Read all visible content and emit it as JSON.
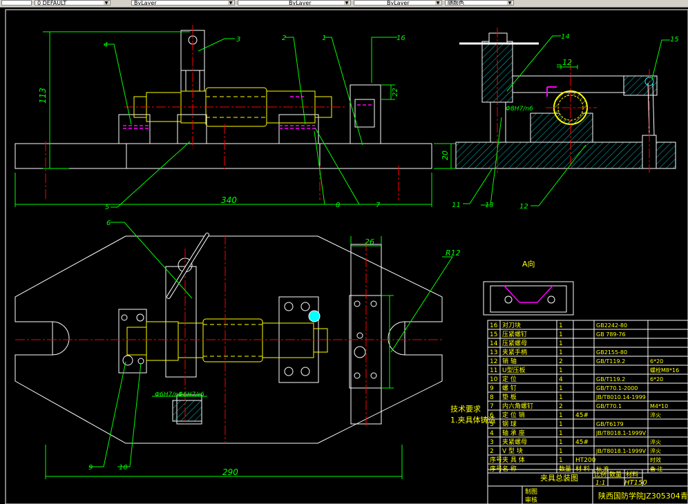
{
  "toolbar": {
    "layer_name": "0 DEFAULT",
    "color": "ByLayer",
    "linetype": "ByLayer",
    "lineweight": "ByLayer",
    "plotstyle": "随颜色"
  },
  "dims": {
    "height_113": "113",
    "width_340": "340",
    "height_20": "20",
    "width_12": "12",
    "height_22": "22",
    "width_26": "26",
    "width_290": "290",
    "radius": "R12",
    "fit_1": "Φ8H7/n6",
    "fit_2": "Φ6H7/n6",
    "fit_3": "Φ6H7/r6"
  },
  "balloons": [
    "1",
    "2",
    "3",
    "4",
    "5",
    "6",
    "7",
    "8",
    "9",
    "10",
    "11",
    "12",
    "13",
    "14",
    "15",
    "16"
  ],
  "view_a_label": "A向",
  "tech_req": {
    "title": "技术要求",
    "item1": "1.夹具体铸造"
  },
  "bom": {
    "rows": [
      {
        "no": "16",
        "name": "对刀块",
        "qty": "1",
        "mat": "",
        "std": "GB2242-80",
        "note": ""
      },
      {
        "no": "15",
        "name": "压紧螺钉",
        "qty": "1",
        "mat": "",
        "std": "GB 789-76",
        "note": ""
      },
      {
        "no": "14",
        "name": "压紧螺母",
        "qty": "1",
        "mat": "",
        "std": "",
        "note": ""
      },
      {
        "no": "13",
        "name": "夹紧手柄",
        "qty": "1",
        "mat": "",
        "std": "GB2155-80",
        "note": ""
      },
      {
        "no": "12",
        "name": "销 轴",
        "qty": "2",
        "mat": "",
        "std": "GB/T119.2",
        "note": "6*20"
      },
      {
        "no": "11",
        "name": "U型压板",
        "qty": "1",
        "mat": "",
        "std": "",
        "note": "螺栓M8*16"
      },
      {
        "no": "10",
        "name": "定 位",
        "qty": "4",
        "mat": "",
        "std": "GB/T119.2",
        "note": "6*20"
      },
      {
        "no": "9",
        "name": "螺 钉",
        "qty": "1",
        "mat": "",
        "std": "GB/T70.1-2000",
        "note": ""
      },
      {
        "no": "8",
        "name": "垫 板",
        "qty": "1",
        "mat": "",
        "std": "JB/T8010.14-1999",
        "note": ""
      },
      {
        "no": "7",
        "name": "内六角螺钉",
        "qty": "2",
        "mat": "",
        "std": "GB/T70.1",
        "note": "M4*10"
      },
      {
        "no": "6",
        "name": "定 位 销",
        "qty": "1",
        "mat": "45#",
        "std": "",
        "note": "淬火"
      },
      {
        "no": "5",
        "name": "钢 球",
        "qty": "1",
        "mat": "",
        "std": "GB/T6179",
        "note": ""
      },
      {
        "no": "4",
        "name": "轴 承 座",
        "qty": "1",
        "mat": "",
        "std": "JB/T8018.1-1999V",
        "note": ""
      },
      {
        "no": "3",
        "name": "夹紧螺母",
        "qty": "1",
        "mat": "45#",
        "std": "",
        "note": "淬火"
      },
      {
        "no": "2",
        "name": "V 型 块",
        "qty": "1",
        "mat": "",
        "std": "JB/T8018.1-1999V",
        "note": "淬火"
      },
      {
        "no": "序号",
        "name": "夹 具 体",
        "qty": "1",
        "mat": "HT200",
        "std": "",
        "note": "时效"
      }
    ],
    "header": {
      "no": "序号",
      "name": "名 称",
      "qty": "数量",
      "mat": "材 料",
      "std": "标 准",
      "note": "备 注"
    }
  },
  "title_block": {
    "drawing_name": "夹具总装图",
    "scale_label": "比例",
    "qty_label": "数量",
    "mat_label": "材料",
    "scale": "1:1",
    "material": "HT150",
    "drawn_by": "制图",
    "checked_by": "审核",
    "school": "陕西国防学院JZ305304青雨"
  }
}
